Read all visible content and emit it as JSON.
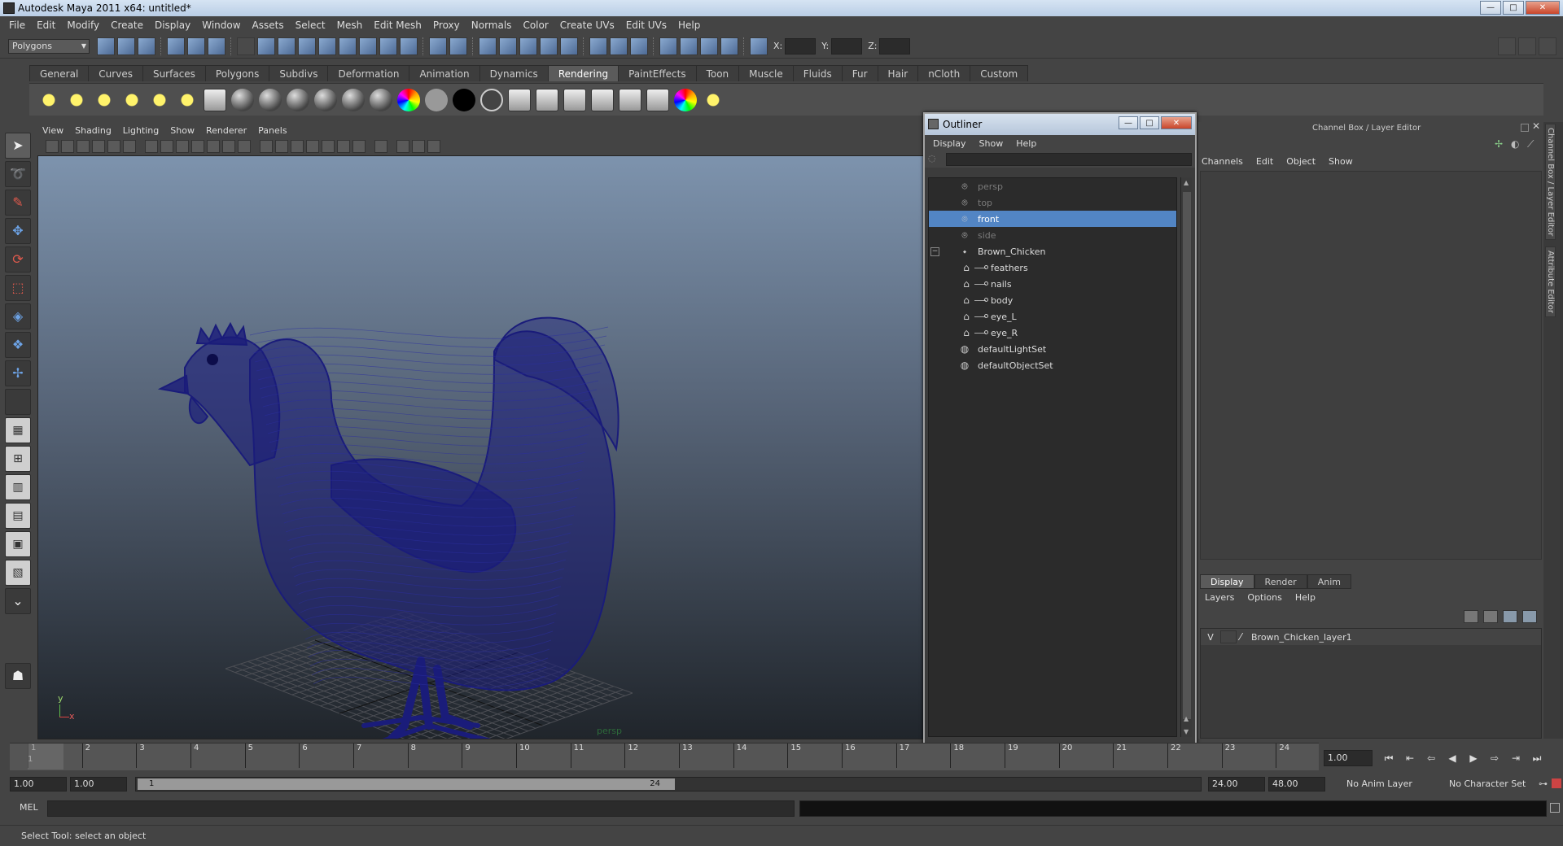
{
  "window": {
    "title": "Autodesk Maya 2011 x64: untitled*",
    "buttons": [
      "—",
      "□",
      "✕"
    ]
  },
  "menubar": [
    "File",
    "Edit",
    "Modify",
    "Create",
    "Display",
    "Window",
    "Assets",
    "Select",
    "Mesh",
    "Edit Mesh",
    "Proxy",
    "Normals",
    "Color",
    "Create UVs",
    "Edit UVs",
    "Help"
  ],
  "statusline": {
    "mode": "Polygons",
    "coord_labels": [
      "X:",
      "Y:",
      "Z:"
    ]
  },
  "shelf": {
    "tabs": [
      "General",
      "Curves",
      "Surfaces",
      "Polygons",
      "Subdivs",
      "Deformation",
      "Animation",
      "Dynamics",
      "Rendering",
      "PaintEffects",
      "Toon",
      "Muscle",
      "Fluids",
      "Fur",
      "Hair",
      "nCloth",
      "Custom"
    ],
    "active_tab": "Rendering"
  },
  "viewport": {
    "menu": [
      "View",
      "Shading",
      "Lighting",
      "Show",
      "Renderer",
      "Panels"
    ],
    "camera": "persp",
    "axis_y": "y",
    "axis_x": "x",
    "mesh_color": "#1a1c7a"
  },
  "outliner": {
    "title": "Outliner",
    "menu": [
      "Display",
      "Show",
      "Help"
    ],
    "items": [
      {
        "label": "persp",
        "icon": "camera-icon",
        "dim": true,
        "selected": false,
        "indent": 0
      },
      {
        "label": "top",
        "icon": "camera-icon",
        "dim": true,
        "selected": false,
        "indent": 0
      },
      {
        "label": "front",
        "icon": "camera-icon",
        "dim": false,
        "selected": true,
        "indent": 0
      },
      {
        "label": "side",
        "icon": "camera-icon",
        "dim": true,
        "selected": false,
        "indent": 0
      },
      {
        "label": "Brown_Chicken",
        "icon": "transform-icon",
        "dim": false,
        "selected": false,
        "indent": 0,
        "expander": "−"
      },
      {
        "label": "feathers",
        "icon": "mesh-icon",
        "dim": false,
        "selected": false,
        "indent": 1
      },
      {
        "label": "nails",
        "icon": "mesh-icon",
        "dim": false,
        "selected": false,
        "indent": 1
      },
      {
        "label": "body",
        "icon": "mesh-icon",
        "dim": false,
        "selected": false,
        "indent": 1
      },
      {
        "label": "eye_L",
        "icon": "mesh-icon",
        "dim": false,
        "selected": false,
        "indent": 1
      },
      {
        "label": "eye_R",
        "icon": "mesh-icon",
        "dim": false,
        "selected": false,
        "indent": 1
      },
      {
        "label": "defaultLightSet",
        "icon": "set-icon",
        "dim": false,
        "selected": false,
        "indent": 0
      },
      {
        "label": "defaultObjectSet",
        "icon": "set-icon",
        "dim": false,
        "selected": false,
        "indent": 0
      }
    ]
  },
  "channelbox": {
    "title": "Channel Box / Layer Editor",
    "menu": [
      "Channels",
      "Edit",
      "Object",
      "Show"
    ],
    "layer_tabs": [
      "Display",
      "Render",
      "Anim"
    ],
    "active_layer_tab": "Display",
    "layer_menu": [
      "Layers",
      "Options",
      "Help"
    ],
    "layers": [
      {
        "visible": "V",
        "name": "Brown_Chicken_layer1"
      }
    ],
    "side_tabs": [
      "Channel Box / Layer Editor",
      "Attribute Editor"
    ]
  },
  "timeslider": {
    "ticks": [
      "1",
      "2",
      "3",
      "4",
      "5",
      "6",
      "7",
      "8",
      "9",
      "10",
      "11",
      "12",
      "13",
      "14",
      "15",
      "16",
      "17",
      "18",
      "19",
      "20",
      "21",
      "22",
      "23",
      "24"
    ],
    "current_frame": "1.00",
    "current_marker": "1"
  },
  "range": {
    "start": "1.00",
    "playback_start": "1.00",
    "thumb_start": "1",
    "thumb_end": "24",
    "playback_end": "24.00",
    "end": "48.00",
    "anim_layer": "No Anim Layer",
    "char_set": "No Character Set"
  },
  "cmdline": {
    "label": "MEL"
  },
  "helpline": {
    "text": "Select Tool: select an object"
  }
}
